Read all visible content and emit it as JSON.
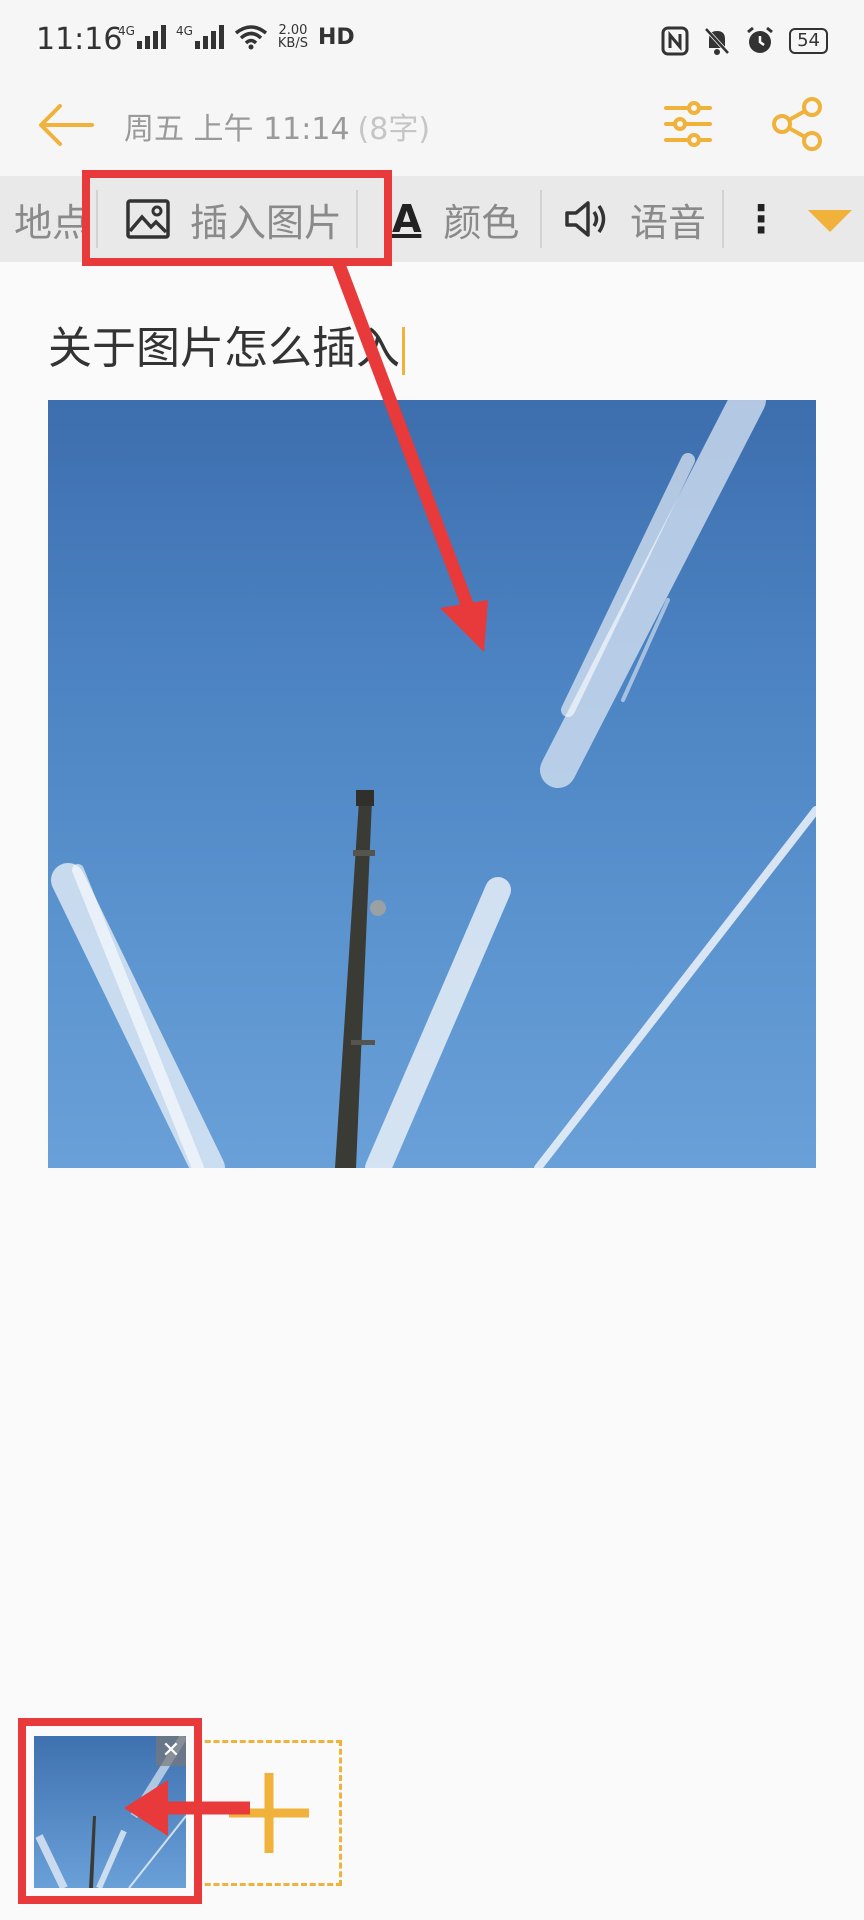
{
  "status_bar": {
    "time": "11:16",
    "net1": "4G",
    "net2": "4G",
    "speed_top": "2.00",
    "speed_unit": "KB/S",
    "hd": "HD",
    "battery": "54"
  },
  "header": {
    "date": "周五 上午 11:14",
    "char_count": "(8字)"
  },
  "toolbar": {
    "partial_prev": "地点",
    "insert_image": "插入图片",
    "color_icon": "A",
    "color": "颜色",
    "voice": "语音",
    "more_partial": "⋮"
  },
  "editor": {
    "title_text": "关于图片怎么插入"
  },
  "attachments": {
    "close": "✕",
    "add": "+"
  },
  "colors": {
    "accent": "#f0b23a",
    "annotation": "#e8393b"
  },
  "icons": [
    "back-arrow-icon",
    "filter-icon",
    "share-icon",
    "image-icon",
    "text-color-icon",
    "speaker-icon",
    "dropdown-triangle-icon",
    "close-icon",
    "plus-icon"
  ]
}
